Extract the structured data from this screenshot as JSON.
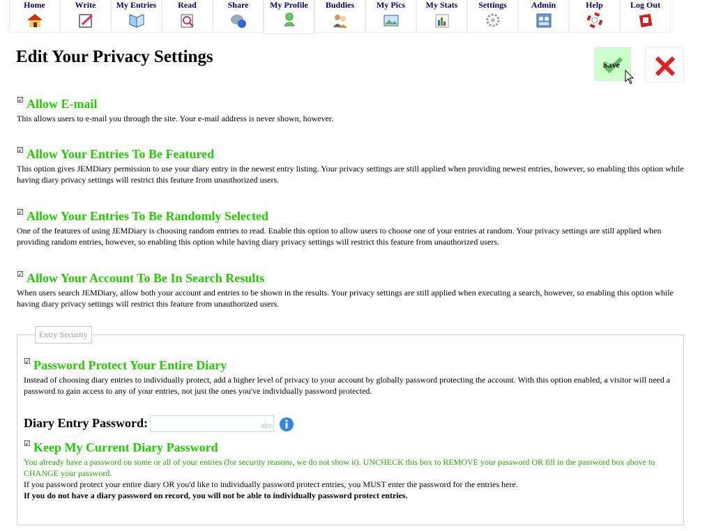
{
  "nav": {
    "items": [
      {
        "label": "Home",
        "icon": "home-icon"
      },
      {
        "label": "Write",
        "icon": "write-icon"
      },
      {
        "label": "My Entries",
        "icon": "entries-book-icon"
      },
      {
        "label": "Read",
        "icon": "read-icon"
      },
      {
        "label": "Share",
        "icon": "share-icon"
      },
      {
        "label": "My Profile",
        "icon": "profile-icon"
      },
      {
        "label": "Buddies",
        "icon": "buddies-icon"
      },
      {
        "label": "My Pics",
        "icon": "pics-icon"
      },
      {
        "label": "My Stats",
        "icon": "stats-icon"
      },
      {
        "label": "Settings",
        "icon": "gear-icon"
      },
      {
        "label": "Admin",
        "icon": "admin-icon"
      },
      {
        "label": "Help",
        "icon": "lifebuoy-icon"
      },
      {
        "label": "Log Out",
        "icon": "logout-icon"
      }
    ],
    "active": "My Profile"
  },
  "page": {
    "title": "Edit Your Privacy Settings",
    "save_label": "Save"
  },
  "options": [
    {
      "title": "Allow E-mail",
      "checked": true,
      "desc": "This allows users to e-mail you through the site. Your e-mail address is never shown, however."
    },
    {
      "title": "Allow Your Entries To Be Featured",
      "checked": true,
      "desc": "This option gives JEMDiary permission to use your diary entry in the newest entry listing. Your privacy settings are still applied when providing newest entries, however, so enabling this option while having diary privacy settings will restrict this feature from unauthorized users."
    },
    {
      "title": "Allow Your Entries To Be Randomly Selected",
      "checked": true,
      "desc": "One of the features of using JEMDiary is choosing random entries to read. Enable this option to allow users to choose one of your entries at random. Your privacy settings are still applied when providing random entries, however, so enabling this option while having diary privacy settings will restrict this feature from unauthorized users."
    },
    {
      "title": "Allow Your Account To Be In Search Results",
      "checked": true,
      "desc": "When users search JEMDiary, allow both your account and entries to be shown in the results. Your privacy settings are still applied when executing a search, however, so enabling this option while having diary privacy settings will restrict this feature from unauthorized users."
    }
  ],
  "security": {
    "legend": "Entry Security",
    "protect": {
      "title": "Password Protect Your Entire Diary",
      "checked": true,
      "desc": "Instead of choosing diary entries to individually protect, add a higher level of privacy to your account by globally password protecting the account. With this option enabled, a visitor will need a password to gain access to any of your entries, not just the ones you've individually password protected."
    },
    "password_label": "Diary Entry Password:",
    "password_value": "",
    "password_hint": "abc",
    "keep": {
      "title": "Keep My Current Diary Password",
      "checked": true,
      "note_green": "You already have a password on some or all of your entries (for security reasons, we do not show it). UNCHECK this box to REMOVE your password OR fill in the password box above to CHANGE your password.",
      "note": "If you password protect your entire diary OR you'd like to individually password protect entries, you MUST enter the password for the entries here.",
      "note_bold": "If you do not have a diary password on record, you will not be able to individually password protect entries."
    }
  }
}
